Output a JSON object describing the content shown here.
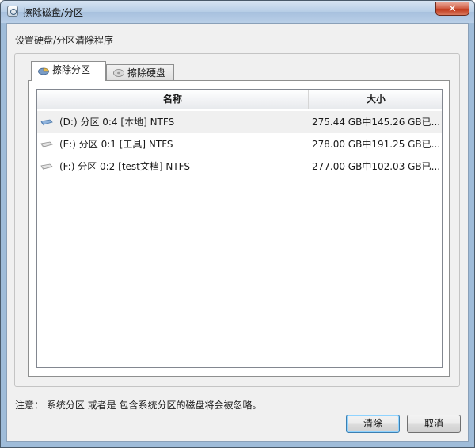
{
  "window": {
    "title": "擦除磁盘/分区",
    "close_label": "✕"
  },
  "heading": "设置硬盘/分区清除程序",
  "tabs": [
    {
      "label": "擦除分区",
      "active": true,
      "icon": "partition-icon"
    },
    {
      "label": "擦除硬盘",
      "active": false,
      "icon": "hard-disk-icon"
    }
  ],
  "table": {
    "columns": [
      "名称",
      "大小"
    ],
    "rows": [
      {
        "name": "(D:) 分区 0:4 [本地]   NTFS",
        "size": "275.44 GB中145.26 GB已...",
        "selected": true
      },
      {
        "name": "(E:) 分区 0:1 [工具]   NTFS",
        "size": "278.00 GB中191.25 GB已...",
        "selected": false
      },
      {
        "name": "(F:) 分区 0:2 [test文档]   NTFS",
        "size": "277.00 GB中102.03 GB已...",
        "selected": false
      }
    ]
  },
  "note": "注意： 系统分区 或者是 包含系统分区的磁盘将会被忽略。",
  "buttons": {
    "ok": "清除",
    "cancel": "取消"
  },
  "colors": {
    "title_bar": "#b6cde6",
    "selected_row": "#f0f0f0",
    "close_button": "#c0391b",
    "default_button_border": "#3c7fb1"
  }
}
